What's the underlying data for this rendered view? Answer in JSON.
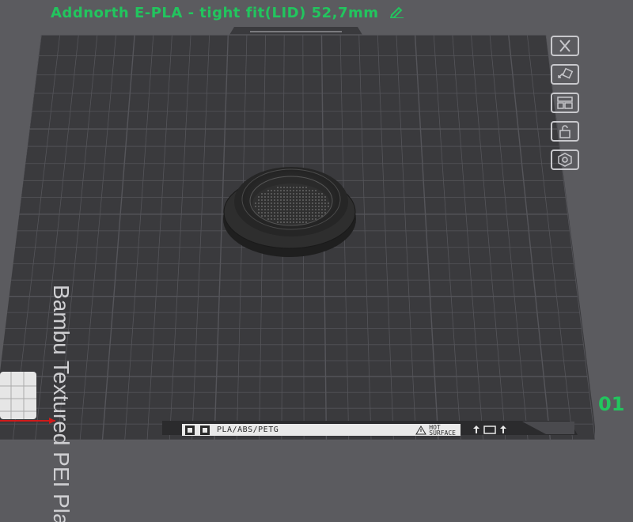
{
  "plate": {
    "name": "Addnorth E-PLA - tight fit(LID) 52,7mm",
    "number": "01",
    "bed_type": "Bambu Textured PEI Plate",
    "material_label": "PLA/ABS/PETG",
    "hot_surface_line1": "HOT",
    "hot_surface_line2": "SURFACE"
  },
  "colors": {
    "background": "#5b5b5f",
    "bed": "#3a3a3d",
    "grid": "#55555a",
    "title_green": "#22c55e",
    "x_axis": "#d11a1a"
  },
  "icons": {
    "edit": "pencil-icon",
    "tools": [
      "close-icon",
      "auto-orient-icon",
      "arrange-icon",
      "lock-icon",
      "settings-icon"
    ]
  }
}
